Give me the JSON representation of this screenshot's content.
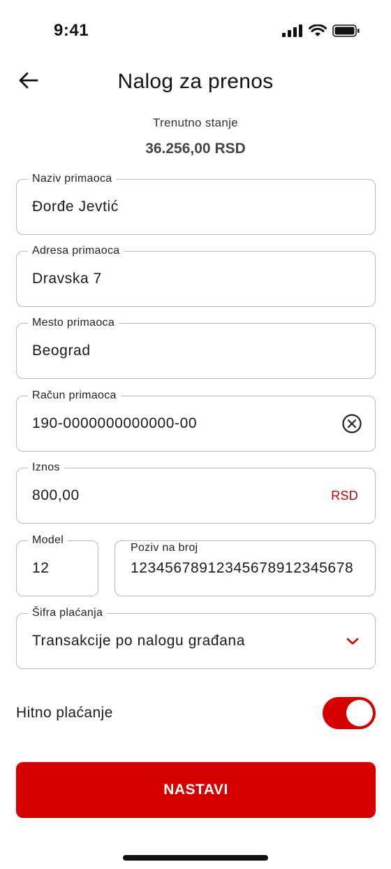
{
  "status_bar": {
    "time": "9:41",
    "icons": [
      "cellular-signal-icon",
      "wifi-icon",
      "battery-icon"
    ]
  },
  "header": {
    "back_icon": "arrow-left-icon",
    "title": "Nalog za prenos"
  },
  "balance": {
    "label": "Trenutno stanje",
    "value": "36.256,00 RSD"
  },
  "form": {
    "recipient_name": {
      "label": "Naziv primaoca",
      "value": "Đorđe Jevtić"
    },
    "recipient_address": {
      "label": "Adresa primaoca",
      "value": "Dravska 7"
    },
    "recipient_city": {
      "label": "Mesto primaoca",
      "value": "Beograd"
    },
    "recipient_account": {
      "label": "Račun primaoca",
      "value": "190-0000000000000-00",
      "clear_icon": "clear-circle-icon"
    },
    "amount": {
      "label": "Iznos",
      "value": "800,00",
      "currency": "RSD"
    },
    "model": {
      "label": "Model",
      "value": "12"
    },
    "reference": {
      "label": "Poziv na broj",
      "value": "12345678912345678912345678"
    },
    "payment_code": {
      "label": "Šifra plaćanja",
      "value": "Transakcije po nalogu građana",
      "dropdown_icon": "chevron-down-icon"
    }
  },
  "urgent": {
    "label": "Hitno plaćanje",
    "enabled": true
  },
  "actions": {
    "continue_label": "NASTAVI"
  },
  "colors": {
    "accent": "#d50000",
    "field_border": "#b9b9b9",
    "text": "#1a1a1a"
  }
}
